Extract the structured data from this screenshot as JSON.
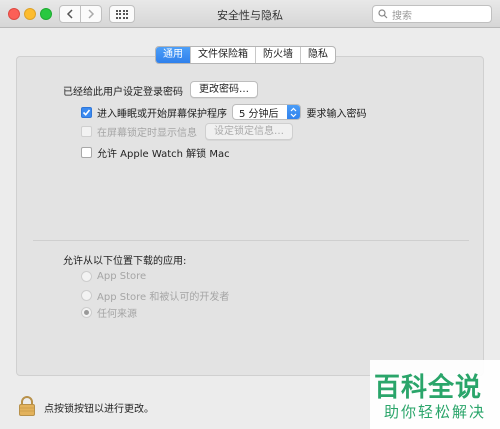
{
  "window": {
    "title": "安全性与隐私"
  },
  "toolbar": {
    "search_placeholder": "搜索"
  },
  "tabs": [
    {
      "label": "通用",
      "active": true
    },
    {
      "label": "文件保险箱",
      "active": false
    },
    {
      "label": "防火墙",
      "active": false
    },
    {
      "label": "隐私",
      "active": false
    }
  ],
  "general": {
    "password_text": "已经给此用户设定登录密码",
    "change_password_button": "更改密码…",
    "require_password": {
      "label_before": "进入睡眠或开始屏幕保护程序",
      "select_value": "5 分钟后",
      "label_after": "要求输入密码",
      "checked": true
    },
    "show_message": {
      "label": "在屏幕锁定时显示信息",
      "button": "设定锁定信息…",
      "checked": false,
      "enabled": false
    },
    "apple_watch": {
      "label": "允许 Apple Watch 解锁 Mac",
      "checked": false
    }
  },
  "downloads": {
    "heading": "允许从以下位置下载的应用:",
    "options": [
      {
        "label": "App Store",
        "selected": false
      },
      {
        "label": "App Store 和被认可的开发者",
        "selected": false
      },
      {
        "label": "任何来源",
        "selected": true
      }
    ]
  },
  "footer": {
    "lock_text": "点按锁按钮以进行更改。"
  },
  "watermark": {
    "line1": "百科全说",
    "line2": "助你轻松解决"
  },
  "colors": {
    "accent": "#2f80ec",
    "watermark": "#2aa56a"
  }
}
